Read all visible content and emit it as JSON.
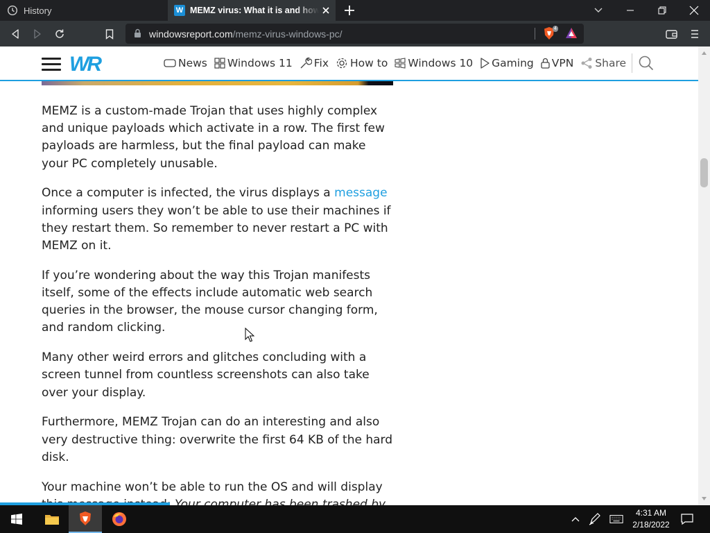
{
  "browser": {
    "tabs": [
      {
        "label": "History",
        "icon": "history-icon"
      },
      {
        "label": "MEMZ virus: What it is and how to remove it",
        "icon": "windowsreport-favicon",
        "favicon_letter": "W"
      }
    ],
    "url_domain": "windowsreport.com",
    "url_path": "/memz-virus-windows-pc/",
    "shield_badge": "4"
  },
  "site": {
    "logo": "WR",
    "nav": [
      {
        "label": "News",
        "icon": "news-icon"
      },
      {
        "label": "Windows 11",
        "icon": "windows-icon"
      },
      {
        "label": "Fix",
        "icon": "wrench-icon"
      },
      {
        "label": "How to",
        "icon": "gear-icon"
      },
      {
        "label": "Windows 10",
        "icon": "windows-icon"
      },
      {
        "label": "Gaming",
        "icon": "play-icon"
      },
      {
        "label": "VPN",
        "icon": "lock-icon"
      },
      {
        "label": "Share",
        "icon": "share-icon"
      }
    ]
  },
  "article": {
    "p1": "MEMZ is a custom-made Trojan that uses highly complex and unique payloads which activate in a row. The first few payloads are harmless, but the final payload can make your PC completely unusable.",
    "p2_before": "Once a computer is infected, the virus displays a ",
    "p2_link": "message",
    "p2_after": " informing users they won’t be able to use their machines if they restart them. So remember to never restart a PC with MEMZ on it.",
    "p3": "If you’re wondering about the way this Trojan manifests itself, some of the effects include automatic web search queries in the browser, the mouse cursor changing form, and random clicking.",
    "p4": "Many other weird errors and glitches concluding with a screen tunnel from countless screenshots can also take over your display.",
    "p5": "Furthermore, MEMZ Trojan can do an interesting and also very destructive thing: overwrite the first 64 KB of the hard disk.",
    "p6_before": "Your machine won’t be able to run the OS and will display this message instead: ",
    "p6_italic": "Your computer has been trashed by"
  },
  "taskbar": {
    "time": "4:31 AM",
    "date": "2/18/2022"
  },
  "colors": {
    "accent": "#1e9fe0",
    "browser_dark": "#202124",
    "toolbar": "#323639"
  }
}
